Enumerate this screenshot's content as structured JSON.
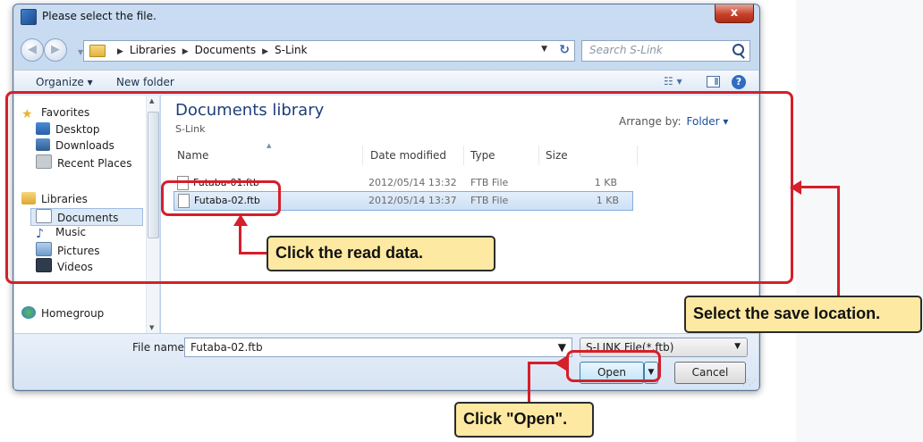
{
  "dialog": {
    "title": "Please select the file.",
    "close_label": "x",
    "breadcrumbs": [
      "Libraries",
      "Documents",
      "S-Link"
    ],
    "search_placeholder": "Search S-Link"
  },
  "toolbar": {
    "organize_label": "Organize ▾",
    "new_folder_label": "New folder"
  },
  "nav": {
    "favorites_label": "Favorites",
    "desktop_label": "Desktop",
    "downloads_label": "Downloads",
    "recent_label": "Recent Places",
    "libraries_label": "Libraries",
    "documents_label": "Documents",
    "music_label": "Music",
    "pictures_label": "Pictures",
    "videos_label": "Videos",
    "homegroup_label": "Homegroup"
  },
  "content": {
    "library_title": "Documents library",
    "library_subtitle": "S-Link",
    "arrange_label": "Arrange by:",
    "arrange_value": "Folder ▾",
    "columns": [
      "Name",
      "Date modified",
      "Type",
      "Size"
    ],
    "files": [
      {
        "name": "Futaba-01.ftb",
        "date": "2012/05/14 13:32",
        "type": "FTB File",
        "size": "1 KB"
      },
      {
        "name": "Futaba-02.ftb",
        "date": "2012/05/14 13:37",
        "type": "FTB File",
        "size": "1 KB"
      }
    ]
  },
  "bottom": {
    "file_name_label": "File name:",
    "file_name_value": "Futaba-02.ftb",
    "filter_value": "S-LINK File(*.ftb)",
    "open_label": "Open",
    "cancel_label": "Cancel"
  },
  "callouts": {
    "read_data": "Click the read data.",
    "save_location": "Select the save location.",
    "open": "Click \"Open\"."
  },
  "colors": {
    "annotation_red": "#d51f2a",
    "callout_fill": "#fde9a2",
    "library_title": "#1e3f7a"
  }
}
